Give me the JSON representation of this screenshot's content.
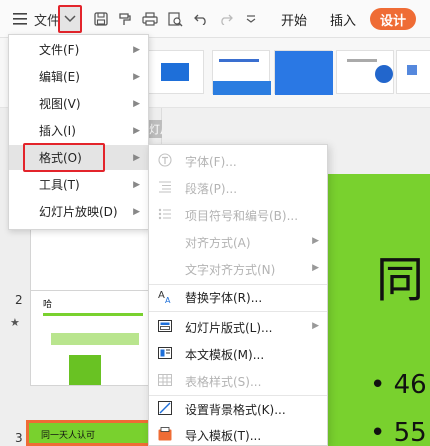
{
  "toolbar": {
    "file_label": "文件",
    "tabs": [
      "开始",
      "插入"
    ],
    "design_tab": "设计",
    "icons": [
      "menu-lines-icon",
      "chevron-down-icon",
      "save-icon",
      "format-painter-icon",
      "print-icon",
      "print-preview-icon",
      "undo-icon",
      "redo-icon",
      "more-icon"
    ]
  },
  "file_menu": {
    "items": [
      {
        "label": "文件(F)",
        "has_submenu": true
      },
      {
        "label": "编辑(E)",
        "has_submenu": true
      },
      {
        "label": "视图(V)",
        "has_submenu": true
      },
      {
        "label": "插入(I)",
        "has_submenu": true
      },
      {
        "label": "格式(O)",
        "has_submenu": true,
        "active": true
      },
      {
        "label": "工具(T)",
        "has_submenu": true
      },
      {
        "label": "幻灯片放映(D)",
        "has_submenu": true
      }
    ]
  },
  "format_menu": {
    "items": [
      {
        "label": "字体(F)...",
        "icon": "font-icon",
        "enabled": false
      },
      {
        "label": "段落(P)...",
        "icon": "paragraph-icon",
        "enabled": false
      },
      {
        "label": "项目符号和编号(B)...",
        "icon": "bullets-icon",
        "enabled": false
      },
      {
        "label": "对齐方式(A)",
        "icon": "",
        "enabled": false,
        "submenu": true
      },
      {
        "label": "文字对齐方式(N)",
        "icon": "",
        "enabled": false,
        "submenu": true
      },
      {
        "label": "替换字体(R)...",
        "icon": "replace-font-icon",
        "enabled": true
      },
      {
        "label": "幻灯片版式(L)...",
        "icon": "slide-layout-icon",
        "enabled": true,
        "submenu": true
      },
      {
        "label": "本文模板(M)...",
        "icon": "template-icon",
        "enabled": true
      },
      {
        "label": "表格样式(S)...",
        "icon": "table-style-icon",
        "enabled": false
      },
      {
        "label": "设置背景格式(K)...",
        "icon": "background-icon",
        "enabled": true
      },
      {
        "label": "导入模板(T)...",
        "icon": "import-template-icon",
        "enabled": true
      }
    ]
  },
  "slide_panel": {
    "pill_text": "灯片",
    "slide_numbers": [
      "2",
      "3"
    ],
    "slide2_title": "哈",
    "slide3_text": "同一天人认可"
  },
  "canvas": {
    "big_char": "同",
    "bullets": [
      "• 46",
      "• 55"
    ]
  },
  "colors": {
    "accent": "#ef6c35",
    "highlight_box": "#e3242b",
    "slide_green": "#79d12e"
  }
}
